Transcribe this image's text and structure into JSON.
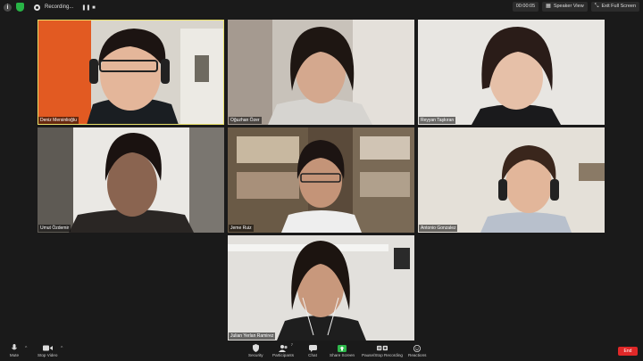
{
  "top_bar": {
    "recording_label": "Recording...",
    "recording_controls": "❚❚  ■",
    "timer": "00:00:05",
    "speaker_view_label": "Speaker View",
    "exit_full_screen_label": "Exit Full Screen"
  },
  "participants": [
    {
      "name": "Deniz Mersinlioğlu",
      "active": true
    },
    {
      "name": "Oğuzhan Özer"
    },
    {
      "name": "Reyyan Taşkıran"
    },
    {
      "name": "Umut Özdemir"
    },
    {
      "name": "Jeme Ruiz"
    },
    {
      "name": "Antonio Gonzalez"
    },
    {
      "name": "Julian Yerlan Ramirez"
    }
  ],
  "toolbar": {
    "mute_label": "Mute",
    "stop_video_label": "Stop Video",
    "security_label": "Security",
    "participants_label": "Participants",
    "participants_count": "7",
    "chat_label": "Chat",
    "share_screen_label": "Share Screen",
    "pause_recording_label": "Pause/Stop Recording",
    "reactions_label": "Reactions",
    "end_label": "End"
  },
  "colors": {
    "background": "#1a1a1a",
    "active_speaker_border": "#e8e06a",
    "share_green": "#2eb84b",
    "end_red": "#e02828"
  }
}
